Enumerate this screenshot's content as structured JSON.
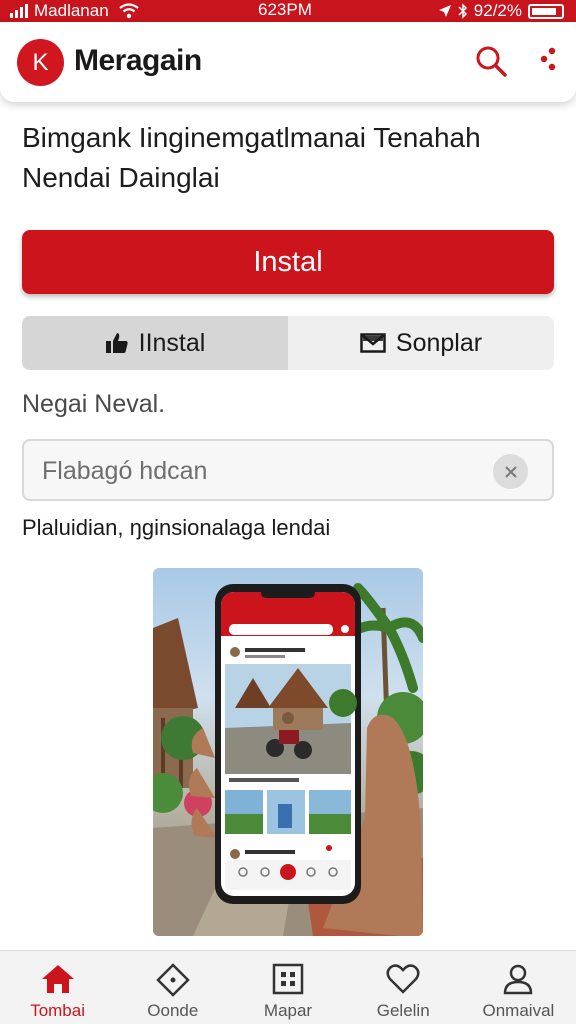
{
  "status_bar": {
    "carrier": "Madlanan",
    "time": "623PM",
    "battery": "92/2%"
  },
  "app_bar": {
    "logo_letter": "K",
    "title": "Meragain",
    "icons": [
      "search-icon",
      "more-icon"
    ]
  },
  "main": {
    "headline": "Bimgank Iinginemgatlmanai Tenahah Nendai Dainglai",
    "install_label": "Instal",
    "tabs": [
      {
        "label": "IInstal",
        "icon": "thumbs-up-icon",
        "selected": true
      },
      {
        "label": "Sonplar",
        "icon": "mail-icon",
        "selected": false
      }
    ],
    "subtitle": "Negai Neval.",
    "search": {
      "placeholder": "Flabagó hdcan",
      "value": ""
    },
    "caption": "Plaluidian, ŋginsionalaga lendai"
  },
  "bottom_nav": {
    "items": [
      {
        "label": "Tombai",
        "icon": "home-icon",
        "active": true
      },
      {
        "label": "Oonde",
        "icon": "diamond-icon",
        "active": false
      },
      {
        "label": "Mapar",
        "icon": "grid-icon",
        "active": false
      },
      {
        "label": "Gelelin",
        "icon": "heart-icon",
        "active": false
      },
      {
        "label": "Onmaival",
        "icon": "person-icon",
        "active": false
      }
    ]
  },
  "colors": {
    "accent": "#cc141c",
    "status_bar": "#c8141c",
    "segment_selected": "#d6d6d6",
    "nav_background": "#f3f3f3"
  }
}
